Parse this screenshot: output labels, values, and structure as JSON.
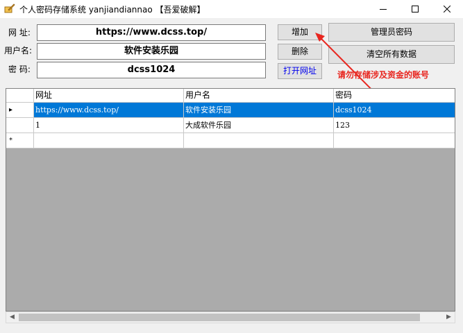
{
  "window": {
    "title": "个人密码存储系统 yanjiandiannao 【吾爱破解】",
    "minimize_icon": "minimize-icon",
    "maximize_icon": "maximize-icon",
    "close_icon": "close-icon"
  },
  "form": {
    "url_label": "网 址:",
    "username_label": "用户名:",
    "password_label": "密 码:",
    "url_value": "https://www.dcss.top/",
    "username_value": "软件安装乐园",
    "password_value": "dcss1024"
  },
  "buttons": {
    "add": "增加",
    "delete": "删除",
    "open_url": "打开网址",
    "admin_password": "管理员密码",
    "clear_all": "清空所有数据"
  },
  "hint": "请勿存储涉及资金的账号",
  "colors": {
    "hint": "#e8261f",
    "selection": "#0078d7",
    "open_url_text": "#0000ee"
  },
  "table": {
    "columns": [
      "网址",
      "用户名",
      "密码"
    ],
    "rows": [
      {
        "marker": "▸",
        "url": "https://www.dcss.top/",
        "username": "软件安装乐园",
        "password": "dcss1024",
        "selected": true
      },
      {
        "marker": "",
        "url": "1",
        "username": "大成软件乐园",
        "password": "123",
        "selected": false
      }
    ],
    "new_row_marker": "*"
  }
}
